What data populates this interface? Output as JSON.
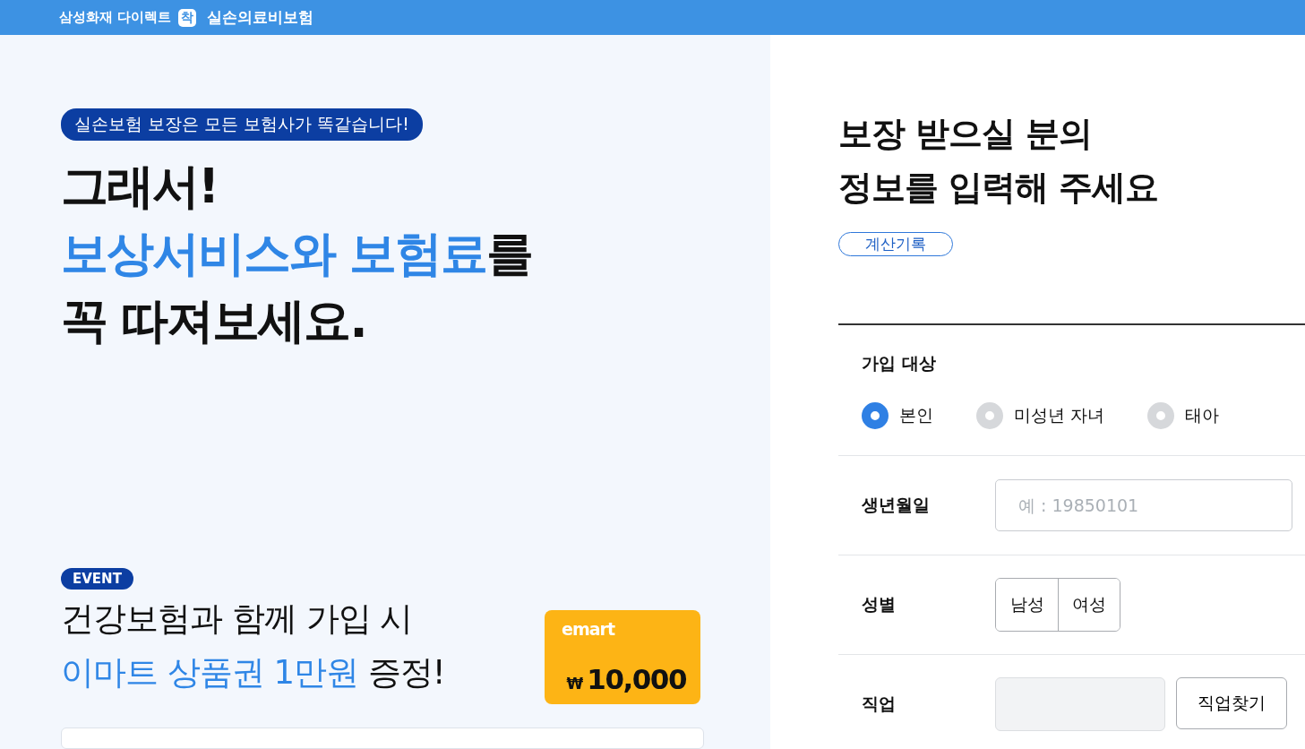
{
  "header": {
    "brand": "삼성화재 다이렉트",
    "badge": "착",
    "product": "실손의료비보험"
  },
  "promo": {
    "pill": "실손보험 보장은 모든 보험사가 똑같습니다!",
    "headline": [
      [
        {
          "text": "그래서!",
          "accent": false
        }
      ],
      [
        {
          "text": "보상서비스와 보험료",
          "accent": true
        },
        {
          "text": "를",
          "accent": false
        }
      ],
      [
        {
          "text": "꼭 따져보세요.",
          "accent": false
        }
      ]
    ],
    "event": {
      "tag": "EVENT",
      "lines": [
        [
          {
            "text": "건강보험과 함께 가입 시",
            "accent": false
          }
        ],
        [
          {
            "text": "이마트 상품권 1만원",
            "accent": true
          },
          {
            "text": " 증정!",
            "accent": false
          }
        ]
      ],
      "voucher": {
        "logo": "emart",
        "currency": "₩",
        "amount": "10,000"
      }
    }
  },
  "form": {
    "title": [
      "보장 받으실 분의",
      "정보를 입력해 주세요"
    ],
    "history_button": "계산기록",
    "rows": [
      {
        "kind": "radio",
        "label": "가입 대상",
        "options": [
          {
            "label": "본인",
            "selected": true
          },
          {
            "label": "미성년 자녀",
            "selected": false
          },
          {
            "label": "태아",
            "selected": false
          }
        ]
      },
      {
        "kind": "input",
        "label": "생년월일",
        "placeholder": "예 : 19850101"
      },
      {
        "kind": "toggle",
        "label": "성별",
        "options": [
          {
            "label": "남성",
            "selected": false
          },
          {
            "label": "여성",
            "selected": false
          }
        ]
      },
      {
        "kind": "search",
        "label": "직업",
        "button": "직업찾기"
      }
    ]
  }
}
